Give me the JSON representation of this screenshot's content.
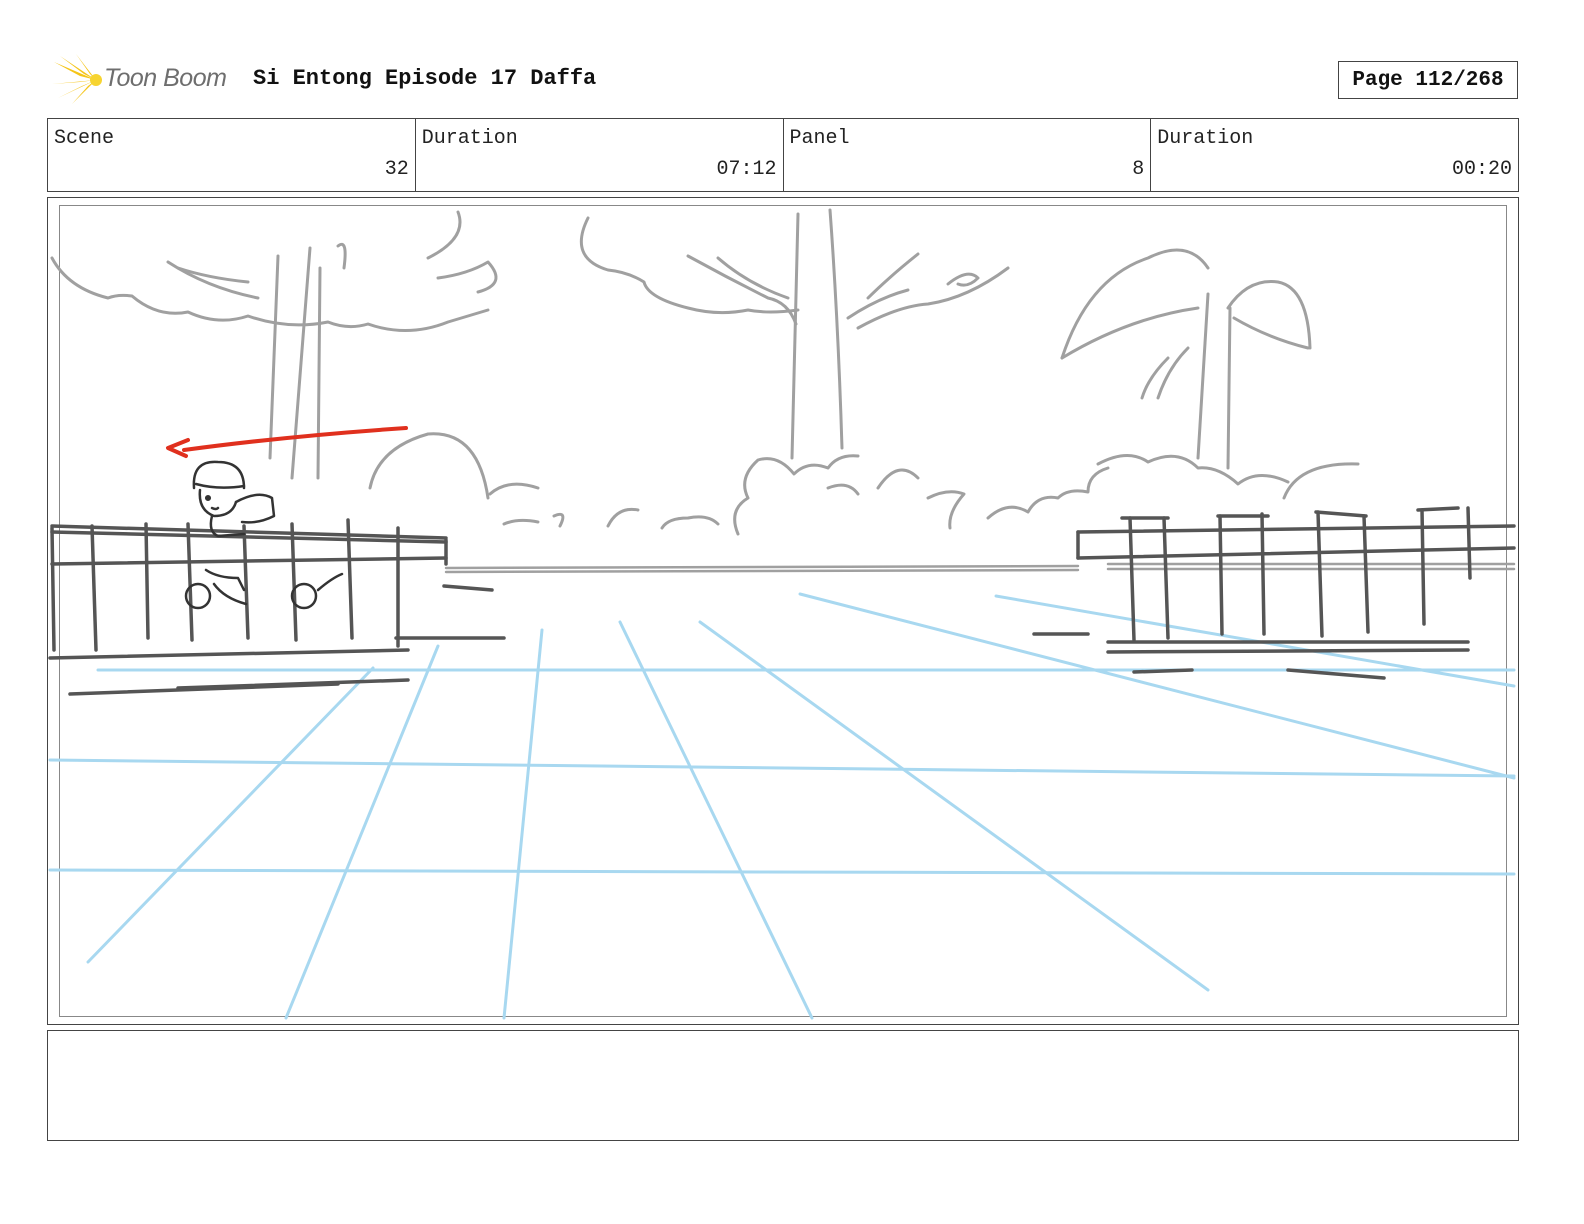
{
  "header": {
    "logo_text": "Toon Boom",
    "title": "Si Entong Episode 17 Daffa",
    "page": "Page 112/268"
  },
  "info": {
    "scene_label": "Scene",
    "scene_value": "32",
    "duration_label": "Duration",
    "duration_value": "07:12",
    "panel_label": "Panel",
    "panel_value": "8",
    "panel_duration_label": "Duration",
    "panel_duration_value": "00:20"
  },
  "colors": {
    "logo_star": "#f5c518",
    "sketch_gray": "#9a9a9a",
    "fence_dark": "#555555",
    "perspective_blue": "#a8d8f0",
    "motion_arrow": "#e0301e"
  },
  "notes": {
    "text": ""
  }
}
